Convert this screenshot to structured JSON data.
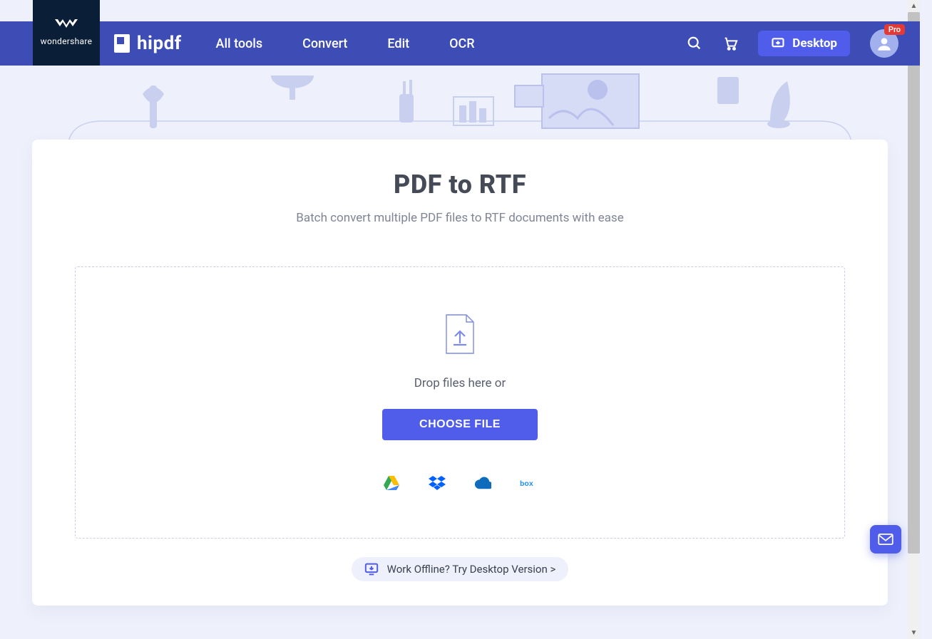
{
  "brand": {
    "company": "wondershare",
    "product": "hipdf"
  },
  "nav": {
    "items": [
      "All tools",
      "Convert",
      "Edit",
      "OCR"
    ]
  },
  "desktop_label": "Desktop",
  "pro_badge": "Pro",
  "page": {
    "title": "PDF to RTF",
    "subtitle": "Batch convert multiple PDF files to RTF documents with ease"
  },
  "dropzone": {
    "text": "Drop files here or",
    "button": "CHOOSE FILE"
  },
  "providers": [
    "google-drive",
    "dropbox",
    "onedrive",
    "box"
  ],
  "offline_cta": "Work Offline? Try Desktop Version >"
}
